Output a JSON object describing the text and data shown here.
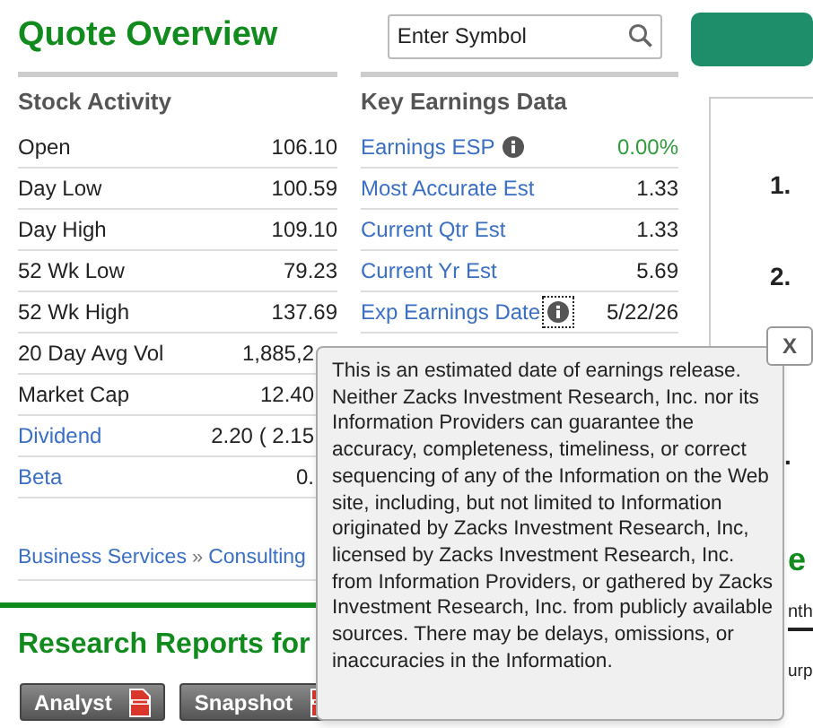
{
  "header": {
    "title": "Quote Overview",
    "search": {
      "placeholder": "Enter Symbol"
    }
  },
  "stock_activity": {
    "title": "Stock Activity",
    "rows": [
      {
        "label": "Open",
        "value": "106.10",
        "link": false,
        "kind": "full"
      },
      {
        "label": "Day Low",
        "value": "100.59",
        "link": false,
        "kind": "full"
      },
      {
        "label": "Day High",
        "value": "109.10",
        "link": false,
        "kind": "full"
      },
      {
        "label": "52 Wk Low",
        "value": "79.23",
        "link": false,
        "kind": "full"
      },
      {
        "label": "52 Wk High",
        "value": "137.69",
        "link": false,
        "kind": "full"
      },
      {
        "label": "20 Day Avg Vol",
        "value": "1,885,2",
        "link": false,
        "kind": "partial"
      },
      {
        "label": "Market Cap",
        "value": "12.40",
        "link": false,
        "kind": "partial"
      },
      {
        "label": "Dividend",
        "value": "2.20 ( 2.15",
        "link": true,
        "kind": "partial"
      },
      {
        "label": "Beta",
        "value": "0.",
        "link": true,
        "kind": "partial"
      }
    ]
  },
  "key_earnings": {
    "title": "Key Earnings Data",
    "rows": [
      {
        "label": "Earnings ESP",
        "value": "0.00%",
        "info": true,
        "focused": false,
        "color": "#2e9a3a"
      },
      {
        "label": "Most Accurate Est",
        "value": "1.33",
        "info": false,
        "color": "#222222"
      },
      {
        "label": "Current Qtr Est",
        "value": "1.33",
        "info": false,
        "color": "#222222"
      },
      {
        "label": "Current Yr Est",
        "value": "5.69",
        "info": false,
        "color": "#222222"
      },
      {
        "label": "Exp Earnings Date",
        "value": "5/22/26",
        "info": true,
        "focused": true,
        "color": "#222222"
      }
    ]
  },
  "breadcrumb": {
    "items": [
      "Business Services",
      "Consulting"
    ],
    "separator": "»"
  },
  "research_reports": {
    "title": "Research Reports for",
    "buttons": [
      "Analyst",
      "Snapshot"
    ]
  },
  "tooltip": {
    "text": "This is an estimated date of earnings release. Neither Zacks Investment Research, Inc. nor its Information Providers can guarantee the accuracy, completeness, timeliness, or correct sequencing of any of the Information on the Web site, including, but not limited to Information originated by Zacks Investment Research, Inc, licensed by Zacks Investment Research, Inc. from Information Providers, or gathered by Zacks Investment Research, Inc. from publicly available sources. There may be delays, omissions, or inaccuracies in the Information.",
    "close": "X"
  },
  "right_panel": {
    "items": [
      "1.",
      "2.",
      "."
    ],
    "section_title": "e",
    "tab": "nth",
    "row": "urp"
  }
}
